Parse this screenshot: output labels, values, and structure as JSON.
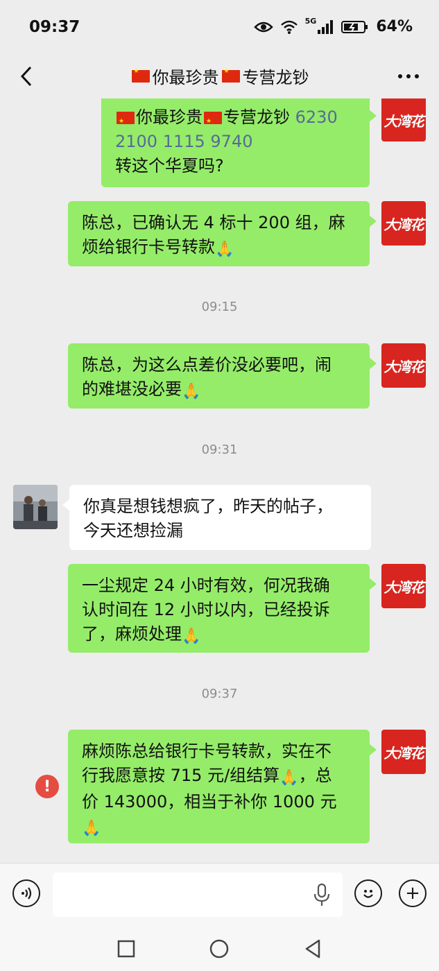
{
  "status": {
    "time": "09:37",
    "network": "5G",
    "battery": "64%"
  },
  "header": {
    "flag1": "🇨🇳",
    "title_a": "你最珍贵",
    "flag2": "🇨🇳",
    "title_b": "专营龙钞"
  },
  "avatars": {
    "me_label": "大湾花"
  },
  "messages": {
    "m1": {
      "flag1": "🇨🇳",
      "part1": "你最珍贵",
      "flag2": "🇨🇳",
      "part2": "专营龙钞 ",
      "card_line1": "6230",
      "card_line2": "2100 1115 9740",
      "line3": "转这个华夏吗?"
    },
    "m2": {
      "line1": "陈总，已确认无 4 标十 200 组，麻",
      "line2": "烦给银行卡号转款",
      "emoji": "🙏"
    },
    "t1": "09:15",
    "m3": {
      "line1": "陈总，为这么点差价没必要吧，闹",
      "line2": "的难堪没必要",
      "emoji": "🙏"
    },
    "t2": "09:31",
    "m4": {
      "line1": "你真是想钱想疯了，昨天的帖子，",
      "line2": "今天还想捡漏"
    },
    "m5": {
      "line1": "一尘规定 24 小时有效，何况我确",
      "line2": "认时间在 12 小时以内，已经投诉",
      "line3": "了，麻烦处理",
      "emoji": "🙏"
    },
    "t3": "09:37",
    "m6": {
      "line1": "麻烦陈总给银行卡号转款，实在不",
      "line2a": "行我愿意按 715 元/组结算",
      "emoji1": "🙏",
      "line2b": "，总",
      "line3": "价 143000，相当于补你 1000 元",
      "emoji2": "🙏"
    },
    "error_mark": "!"
  },
  "input": {
    "placeholder": "",
    "emoji_btn": "☺",
    "plus_btn": "+"
  }
}
